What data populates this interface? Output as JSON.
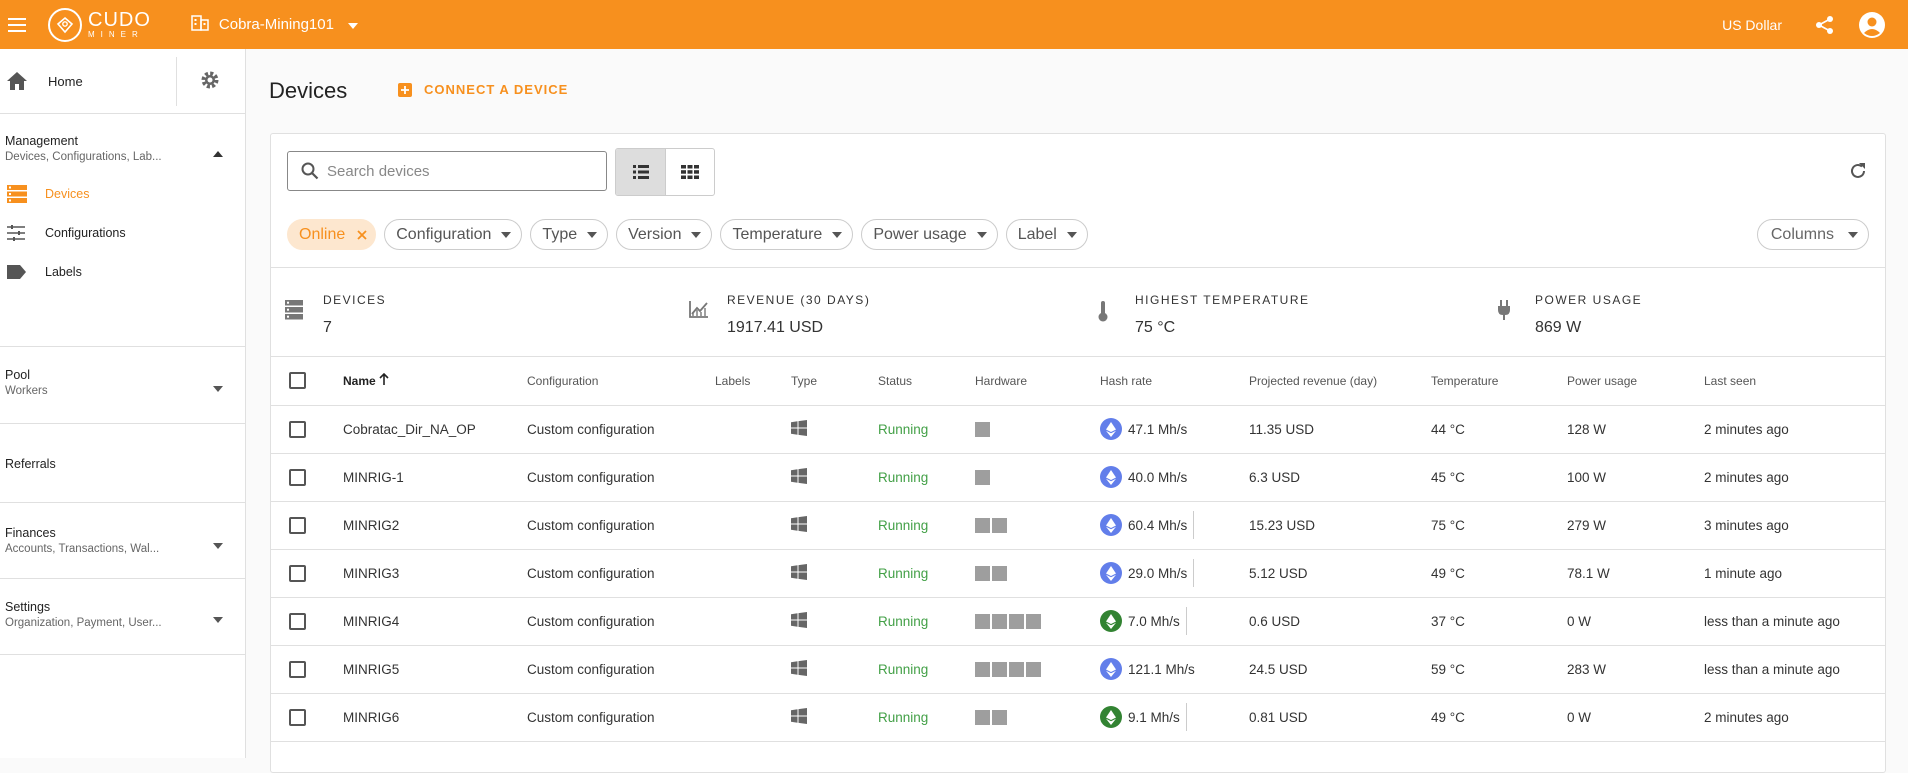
{
  "topbar": {
    "logo_text": "CUDO",
    "logo_sub": "MINER",
    "org_name": "Cobra-Mining101",
    "currency": "US Dollar"
  },
  "sidebar": {
    "home": "Home",
    "management": {
      "title": "Management",
      "subtitle": "Devices, Configurations, Lab..."
    },
    "items": [
      {
        "label": "Devices",
        "icon": "devices-icon",
        "active": true
      },
      {
        "label": "Configurations",
        "icon": "tune-icon",
        "active": false
      },
      {
        "label": "Labels",
        "icon": "label-icon",
        "active": false
      }
    ],
    "pool": {
      "title": "Pool",
      "subtitle": "Workers"
    },
    "referrals": {
      "title": "Referrals"
    },
    "finances": {
      "title": "Finances",
      "subtitle": "Accounts, Transactions, Wal..."
    },
    "settings": {
      "title": "Settings",
      "subtitle": "Organization, Payment, User..."
    }
  },
  "main": {
    "title": "Devices",
    "connect_label": "CONNECT A DEVICE",
    "search_placeholder": "Search devices",
    "filters": {
      "online": "Online",
      "configuration": "Configuration",
      "type": "Type",
      "version": "Version",
      "temperature": "Temperature",
      "power_usage": "Power usage",
      "label": "Label",
      "columns": "Columns"
    },
    "stats": {
      "devices": {
        "label": "DEVICES",
        "value": "7"
      },
      "revenue": {
        "label": "REVENUE (30 DAYS)",
        "value": "1917.41 USD"
      },
      "temperature": {
        "label": "HIGHEST TEMPERATURE",
        "value": "75 °C"
      },
      "power": {
        "label": "POWER USAGE",
        "value": "869 W"
      }
    },
    "columns": {
      "name": "Name",
      "configuration": "Configuration",
      "labels": "Labels",
      "type": "Type",
      "status": "Status",
      "hardware": "Hardware",
      "hash_rate": "Hash rate",
      "projected_revenue": "Projected revenue (day)",
      "temperature": "Temperature",
      "power_usage": "Power usage",
      "last_seen": "Last seen"
    },
    "rows": [
      {
        "name": "Cobratac_Dir_NA_OP",
        "configuration": "Custom configuration",
        "status": "Running",
        "hw": 1,
        "coin": "eth",
        "hash": "47.1 Mh/s",
        "revenue": "11.35 USD",
        "temp": "44 °C",
        "power": "128 W",
        "last_seen": "2 minutes ago"
      },
      {
        "name": "MINRIG-1",
        "configuration": "Custom configuration",
        "status": "Running",
        "hw": 1,
        "coin": "eth",
        "hash": "40.0 Mh/s",
        "revenue": "6.3 USD",
        "temp": "45 °C",
        "power": "100 W",
        "last_seen": "2 minutes ago"
      },
      {
        "name": "MINRIG2",
        "configuration": "Custom configuration",
        "status": "Running",
        "hw": 2,
        "coin": "eth",
        "hash": "60.4 Mh/s",
        "revenue": "15.23 USD",
        "temp": "75 °C",
        "power": "279 W",
        "last_seen": "3 minutes ago"
      },
      {
        "name": "MINRIG3",
        "configuration": "Custom configuration",
        "status": "Running",
        "hw": 2,
        "coin": "eth",
        "hash": "29.0 Mh/s",
        "revenue": "5.12 USD",
        "temp": "49 °C",
        "power": "78.1 W",
        "last_seen": "1 minute ago"
      },
      {
        "name": "MINRIG4",
        "configuration": "Custom configuration",
        "status": "Running",
        "hw": 4,
        "coin": "etc",
        "hash": "7.0 Mh/s",
        "revenue": "0.6 USD",
        "temp": "37 °C",
        "power": "0 W",
        "last_seen": "less than a minute ago"
      },
      {
        "name": "MINRIG5",
        "configuration": "Custom configuration",
        "status": "Running",
        "hw": 4,
        "coin": "eth",
        "hash": "121.1 Mh/s",
        "revenue": "24.5 USD",
        "temp": "59 °C",
        "power": "283 W",
        "last_seen": "less than a minute ago"
      },
      {
        "name": "MINRIG6",
        "configuration": "Custom configuration",
        "status": "Running",
        "hw": 2,
        "coin": "etc",
        "hash": "9.1 Mh/s",
        "revenue": "0.81 USD",
        "temp": "49 °C",
        "power": "0 W",
        "last_seen": "2 minutes ago"
      }
    ]
  },
  "colors": {
    "brand": "#f7901e",
    "running": "#43a047",
    "eth": "#627eea",
    "etc": "#328332"
  }
}
